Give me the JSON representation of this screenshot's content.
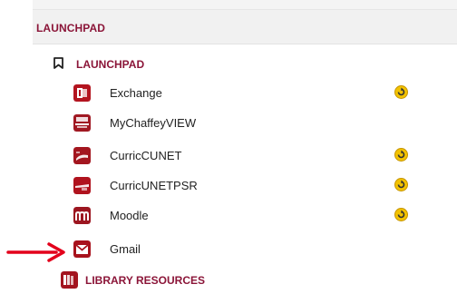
{
  "section": {
    "title": "LAUNCHPAD"
  },
  "launchpad": {
    "title": "LAUNCHPAD",
    "bookmark_icon": "bookmark-icon",
    "items": [
      {
        "label": "Exchange",
        "icon": "exchange-icon",
        "has_refresh": true
      },
      {
        "label": "MyChaffeyVIEW",
        "icon": "mychaffeyview-icon",
        "has_refresh": false
      },
      {
        "label": "CurricCUNET",
        "icon": "curriccunet-icon",
        "has_refresh": true
      },
      {
        "label": "CurricUNETPSR",
        "icon": "curricunetpsr-icon",
        "has_refresh": true
      },
      {
        "label": "Moodle",
        "icon": "moodle-icon",
        "has_refresh": true
      },
      {
        "label": "Gmail",
        "icon": "gmail-icon",
        "has_refresh": false
      }
    ]
  },
  "library": {
    "title": "LIBRARY RESOURCES",
    "icon": "library-icon"
  },
  "colors": {
    "accent": "#8b1538",
    "arrow": "#e3001b",
    "refresh": "#e3a800"
  }
}
